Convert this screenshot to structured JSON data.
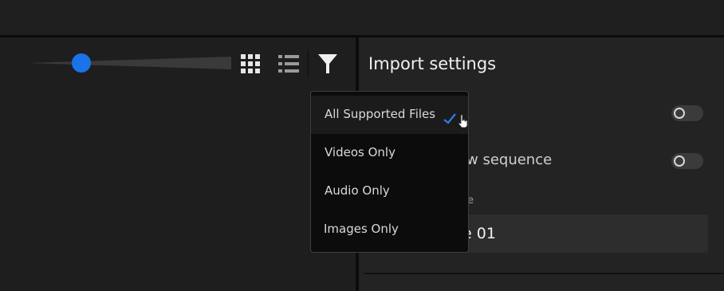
{
  "toolbar": {
    "zoom_slider_value": 0.26,
    "grid_view_icon": "grid-icon",
    "list_view_icon": "list-icon",
    "filter_icon": "filter-icon"
  },
  "import_settings": {
    "title": "Import settings",
    "row1_label": "",
    "row2_label": "w sequence",
    "name_field_label": "e",
    "name_field_value": "e 01"
  },
  "filter_menu": {
    "items": [
      {
        "label": "All Supported Files",
        "selected": true
      },
      {
        "label": "Videos Only",
        "selected": false
      },
      {
        "label": "Audio Only",
        "selected": false
      },
      {
        "label": "Images Only",
        "selected": false
      }
    ],
    "check_icon": "checkmark-icon"
  },
  "colors": {
    "accent": "#1a73e8",
    "background": "#1f1f1f",
    "menu_background": "#0c0c0c"
  }
}
